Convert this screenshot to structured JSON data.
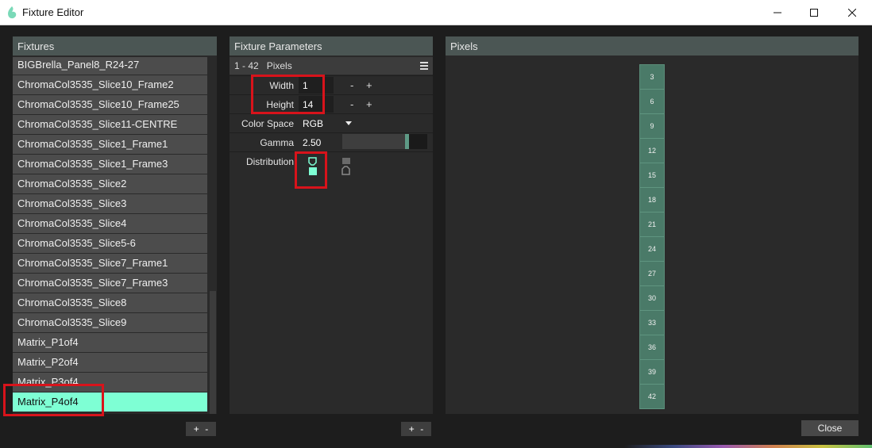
{
  "window": {
    "title": "Fixture Editor"
  },
  "fixtures": {
    "header": "Fixtures",
    "items": [
      "BIGBrella_Panel8_R24-27",
      "ChromaCol3535_Slice10_Frame2",
      "ChromaCol3535_Slice10_Frame25",
      "ChromaCol3535_Slice11-CENTRE",
      "ChromaCol3535_Slice1_Frame1",
      "ChromaCol3535_Slice1_Frame3",
      "ChromaCol3535_Slice2",
      "ChromaCol3535_Slice3",
      "ChromaCol3535_Slice4",
      "ChromaCol3535_Slice5-6",
      "ChromaCol3535_Slice7_Frame1",
      "ChromaCol3535_Slice7_Frame3",
      "ChromaCol3535_Slice8",
      "ChromaCol3535_Slice9",
      "Matrix_P1of4",
      "Matrix_P2of4",
      "Matrix_P3of4",
      "Matrix_P4of4"
    ],
    "selected_index": 17,
    "add_label": "+",
    "remove_label": "-"
  },
  "parameters": {
    "header": "Fixture Parameters",
    "group_range": "1 - 42",
    "group_name": "Pixels",
    "width_label": "Width",
    "width_value": "1",
    "height_label": "Height",
    "height_value": "14",
    "minus_label": "-",
    "plus_label": "+",
    "color_space_label": "Color Space",
    "color_space_value": "RGB",
    "gamma_label": "Gamma",
    "gamma_value": "2.50",
    "gamma_fraction": 0.74,
    "distribution_label": "Distribution",
    "add_label": "+",
    "remove_label": "-"
  },
  "pixels": {
    "header": "Pixels",
    "cells": [
      "3",
      "6",
      "9",
      "12",
      "15",
      "18",
      "21",
      "24",
      "27",
      "30",
      "33",
      "36",
      "39",
      "42"
    ]
  },
  "footer": {
    "close_label": "Close"
  },
  "colors": {
    "accent": "#7effd4",
    "pixel": "#4a7a68",
    "highlight": "#d8131b"
  }
}
